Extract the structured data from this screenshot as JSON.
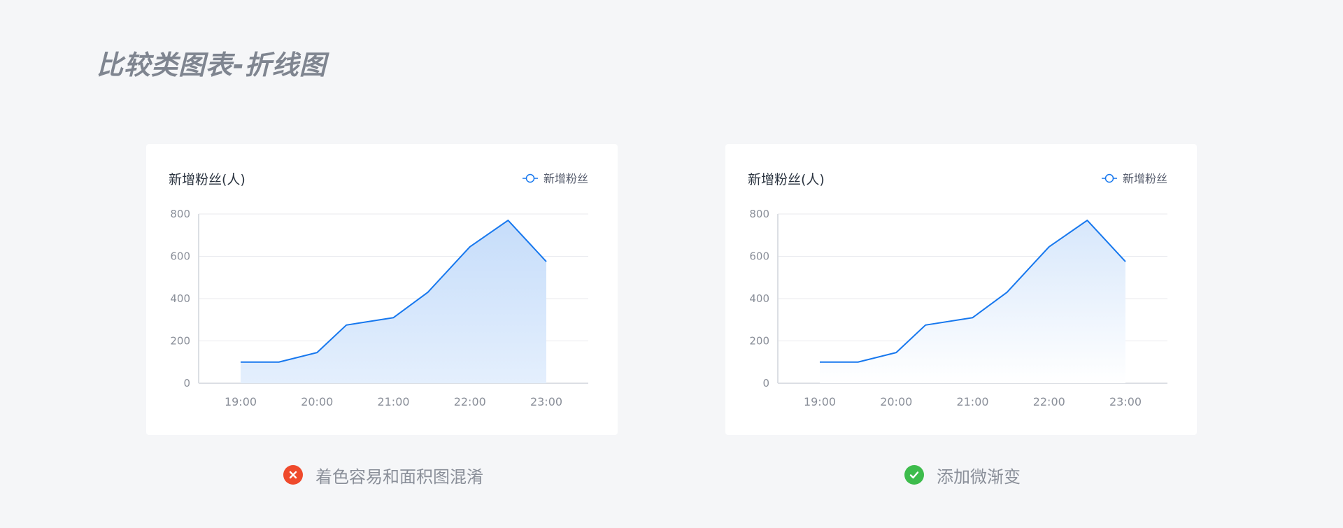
{
  "page": {
    "title": "比较类图表-折线图"
  },
  "colors": {
    "line": "#1677ee",
    "grid": "#e8eaee",
    "axis_label": "#8a8f99",
    "bad": "#ef4a2c",
    "good": "#3dbc4c"
  },
  "charts": [
    {
      "title": "新增粉丝(人)",
      "legend_label": "新增粉丝",
      "fill_style": "solid",
      "caption": "着色容易和面积图混淆",
      "caption_icon": "error-x-icon"
    },
    {
      "title": "新增粉丝(人)",
      "legend_label": "新增粉丝",
      "fill_style": "gradient",
      "caption": "添加微渐变",
      "caption_icon": "check-icon"
    }
  ],
  "chart_data": [
    {
      "type": "area",
      "title": "新增粉丝(人)",
      "legend": [
        "新增粉丝"
      ],
      "legend_position": "top-right",
      "x_ticks": [
        "19:00",
        "20:00",
        "21:00",
        "22:00",
        "23:00"
      ],
      "y_ticks": [
        "0",
        "200",
        "400",
        "600",
        "800"
      ],
      "ylim": [
        0,
        800
      ],
      "grid": true,
      "x": [
        "19:00",
        "19:30",
        "20:00",
        "20:23",
        "21:00",
        "21:27",
        "22:00",
        "22:30",
        "23:00"
      ],
      "series": [
        {
          "name": "新增粉丝",
          "values": [
            100,
            100,
            145,
            275,
            310,
            430,
            645,
            770,
            575
          ]
        }
      ]
    },
    {
      "type": "area",
      "title": "新增粉丝(人)",
      "legend": [
        "新增粉丝"
      ],
      "legend_position": "top-right",
      "x_ticks": [
        "19:00",
        "20:00",
        "21:00",
        "22:00",
        "23:00"
      ],
      "y_ticks": [
        "0",
        "200",
        "400",
        "600",
        "800"
      ],
      "ylim": [
        0,
        800
      ],
      "grid": true,
      "x": [
        "19:00",
        "19:30",
        "20:00",
        "20:23",
        "21:00",
        "21:27",
        "22:00",
        "22:30",
        "23:00"
      ],
      "series": [
        {
          "name": "新增粉丝",
          "values": [
            100,
            100,
            145,
            275,
            310,
            430,
            645,
            770,
            575
          ]
        }
      ]
    }
  ]
}
